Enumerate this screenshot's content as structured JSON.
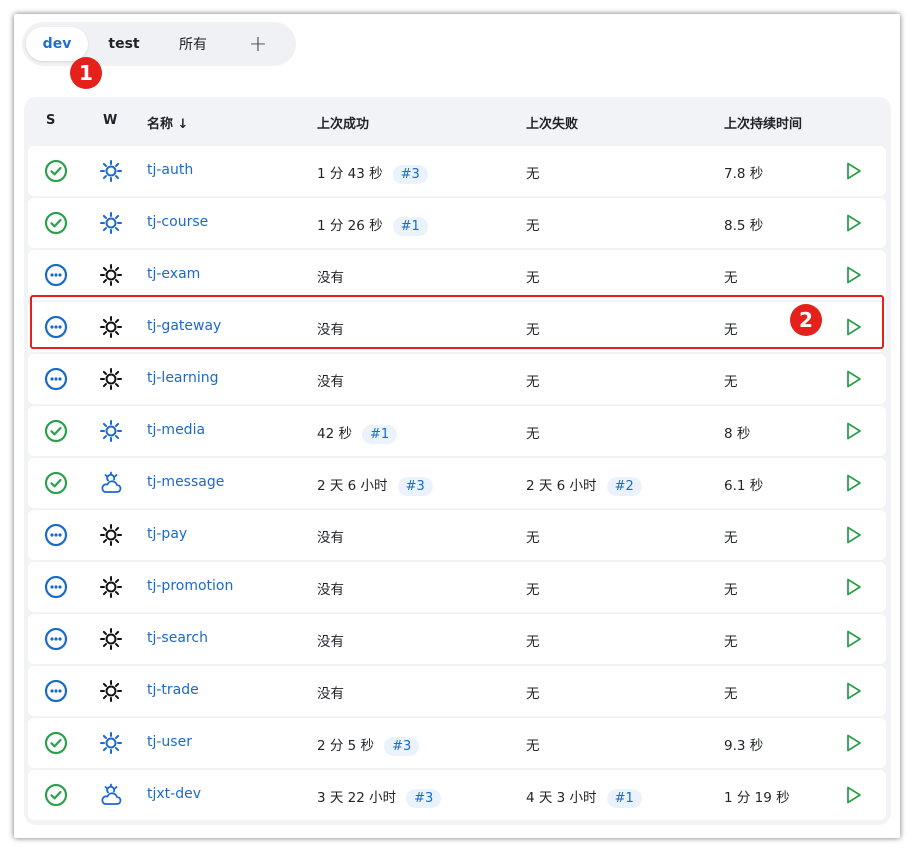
{
  "tabs": {
    "dev": "dev",
    "test": "test",
    "all": "所有",
    "add": "+"
  },
  "markers": {
    "m1": "1",
    "m2": "2"
  },
  "columns": {
    "s": "S",
    "w": "W",
    "name": "名称 ↓",
    "last_success": "上次成功",
    "last_failure": "上次失败",
    "last_duration": "上次持续时间"
  },
  "colors": {
    "success": "#2e9f4e",
    "notbuilt": "#1b6ac9",
    "run": "#2e9f4e",
    "highlight": "#e4211b"
  },
  "rows": [
    {
      "status": "success",
      "weather": "sunny-blue",
      "name": "tj-auth",
      "success": "1 分 43 秒",
      "success_build": "#3",
      "failure": "无",
      "failure_build": "",
      "duration": "7.8 秒"
    },
    {
      "status": "success",
      "weather": "sunny-blue",
      "name": "tj-course",
      "success": "1 分 26 秒",
      "success_build": "#1",
      "failure": "无",
      "failure_build": "",
      "duration": "8.5 秒"
    },
    {
      "status": "notbuilt",
      "weather": "sunny-black",
      "name": "tj-exam",
      "success": "没有",
      "success_build": "",
      "failure": "无",
      "failure_build": "",
      "duration": "无"
    },
    {
      "status": "notbuilt",
      "weather": "sunny-black",
      "name": "tj-gateway",
      "success": "没有",
      "success_build": "",
      "failure": "无",
      "failure_build": "",
      "duration": "无"
    },
    {
      "status": "notbuilt",
      "weather": "sunny-black",
      "name": "tj-learning",
      "success": "没有",
      "success_build": "",
      "failure": "无",
      "failure_build": "",
      "duration": "无"
    },
    {
      "status": "success",
      "weather": "sunny-blue",
      "name": "tj-media",
      "success": "42 秒",
      "success_build": "#1",
      "failure": "无",
      "failure_build": "",
      "duration": "8 秒"
    },
    {
      "status": "success",
      "weather": "cloudy-blue",
      "name": "tj-message",
      "success": "2 天 6 小时",
      "success_build": "#3",
      "failure": "2 天 6 小时",
      "failure_build": "#2",
      "duration": "6.1 秒"
    },
    {
      "status": "notbuilt",
      "weather": "sunny-black",
      "name": "tj-pay",
      "success": "没有",
      "success_build": "",
      "failure": "无",
      "failure_build": "",
      "duration": "无"
    },
    {
      "status": "notbuilt",
      "weather": "sunny-black",
      "name": "tj-promotion",
      "success": "没有",
      "success_build": "",
      "failure": "无",
      "failure_build": "",
      "duration": "无"
    },
    {
      "status": "notbuilt",
      "weather": "sunny-black",
      "name": "tj-search",
      "success": "没有",
      "success_build": "",
      "failure": "无",
      "failure_build": "",
      "duration": "无"
    },
    {
      "status": "notbuilt",
      "weather": "sunny-black",
      "name": "tj-trade",
      "success": "没有",
      "success_build": "",
      "failure": "无",
      "failure_build": "",
      "duration": "无"
    },
    {
      "status": "success",
      "weather": "sunny-blue",
      "name": "tj-user",
      "success": "2 分 5 秒",
      "success_build": "#3",
      "failure": "无",
      "failure_build": "",
      "duration": "9.3 秒"
    },
    {
      "status": "success",
      "weather": "cloudy-blue",
      "name": "tjxt-dev",
      "success": "3 天 22 小时",
      "success_build": "#3",
      "failure": "4 天 3 小时",
      "failure_build": "#1",
      "duration": "1 分 19 秒"
    }
  ]
}
